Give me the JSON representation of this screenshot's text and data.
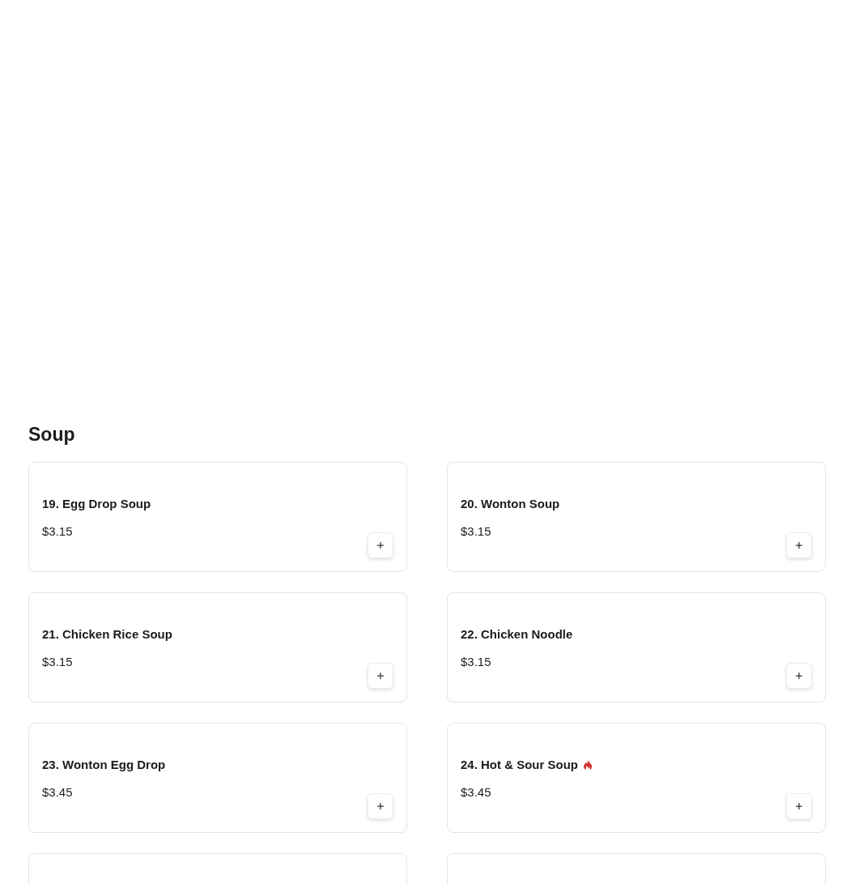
{
  "section": {
    "title": "Soup"
  },
  "items": [
    {
      "name": "19. Egg Drop Soup",
      "price": "$3.15",
      "spicy": false
    },
    {
      "name": "20. Wonton Soup",
      "price": "$3.15",
      "spicy": false
    },
    {
      "name": "21. Chicken Rice Soup",
      "price": "$3.15",
      "spicy": false
    },
    {
      "name": "22. Chicken Noodle",
      "price": "$3.15",
      "spicy": false
    },
    {
      "name": "23. Wonton Egg Drop",
      "price": "$3.45",
      "spicy": false
    },
    {
      "name": "24. Hot & Sour Soup",
      "price": "$3.45",
      "spicy": true
    }
  ],
  "more_items": [
    {
      "kind": "card"
    },
    {
      "kind": "card"
    }
  ]
}
